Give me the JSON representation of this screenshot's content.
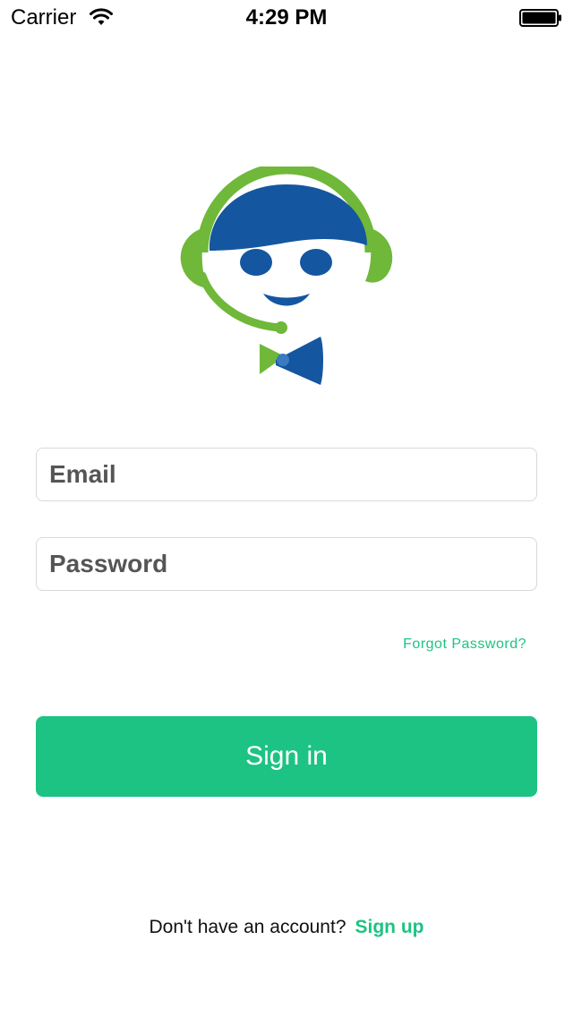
{
  "status_bar": {
    "carrier": "Carrier",
    "time": "4:29 PM"
  },
  "logo": {
    "icon": "support-agent-headset-logo",
    "colors": {
      "green": "#6fb83a",
      "blue": "#1556a0"
    }
  },
  "form": {
    "email_placeholder": "Email",
    "password_placeholder": "Password",
    "forgot_password": "Forgot Password?",
    "sign_in": "Sign in"
  },
  "footer": {
    "prompt": "Don't have an account?",
    "sign_up": "Sign up"
  },
  "colors": {
    "accent": "#1dc383",
    "field_border": "#d9d9d9"
  }
}
